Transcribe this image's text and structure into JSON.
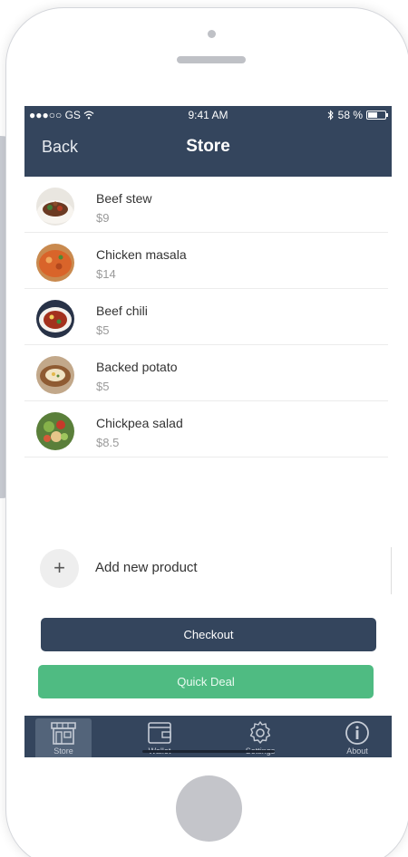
{
  "status_bar": {
    "carrier": "●●●○○ GS",
    "time": "9:41 AM",
    "battery": "58 %",
    "battery_level": 0.58
  },
  "nav": {
    "back_label": "Back",
    "title": "Store"
  },
  "products": [
    {
      "name": "Beef stew",
      "price": "$9"
    },
    {
      "name": "Chicken masala",
      "price": "$14"
    },
    {
      "name": "Beef chili",
      "price": "$5"
    },
    {
      "name": "Backed potato",
      "price": "$5"
    },
    {
      "name": "Chickpea salad",
      "price": "$8.5"
    }
  ],
  "add_product": {
    "icon": "+",
    "label": "Add new product"
  },
  "buttons": {
    "checkout": "Checkout",
    "quick_deal": "Quick Deal"
  },
  "tabs": [
    {
      "label": "Store",
      "icon": "store-icon",
      "active": true
    },
    {
      "label": "Wallet",
      "icon": "wallet-icon",
      "active": false
    },
    {
      "label": "Settings",
      "icon": "gear-icon",
      "active": false
    },
    {
      "label": "About",
      "icon": "info-icon",
      "active": false
    }
  ],
  "colors": {
    "primary": "#34455d",
    "accent_green": "#4fbb82"
  }
}
